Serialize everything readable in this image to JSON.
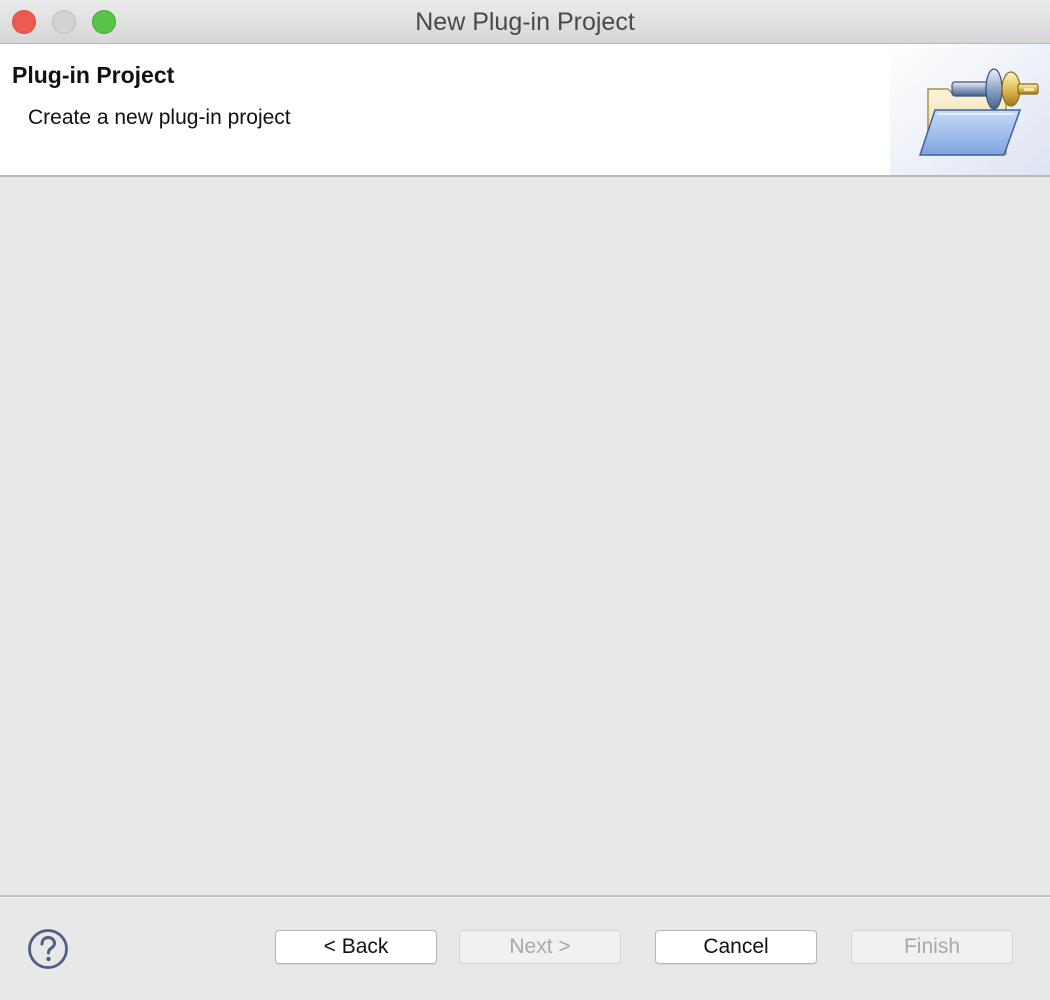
{
  "window": {
    "title": "New Plug-in Project"
  },
  "banner": {
    "title": "Plug-in Project",
    "description": "Create a new plug-in project",
    "icon": "plugin-folder-icon"
  },
  "footer": {
    "help_icon": "question-mark-circle-icon",
    "buttons": {
      "back": {
        "label": "< Back",
        "enabled": true
      },
      "next": {
        "label": "Next >",
        "enabled": false
      },
      "cancel": {
        "label": "Cancel",
        "enabled": true
      },
      "finish": {
        "label": "Finish",
        "enabled": false
      }
    }
  },
  "colors": {
    "close": "#ee5b52",
    "minimize": "#d3d3d3",
    "maximize": "#59c24a",
    "content_background": "#e8e8e8",
    "disabled_text": "#a8a8a8"
  }
}
